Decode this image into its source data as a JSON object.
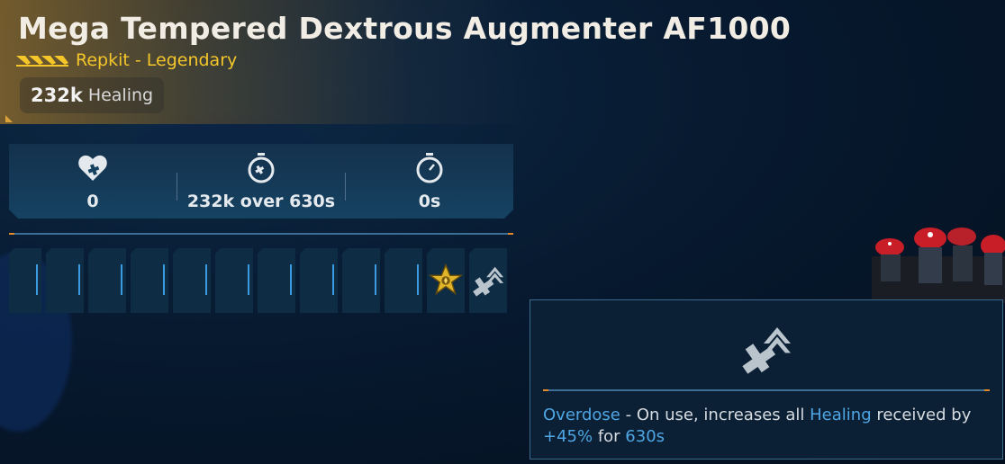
{
  "item": {
    "name": "Mega Tempered Dextrous Augmenter AF1000",
    "rarity": "Repkit - Legendary",
    "primary_stat": {
      "value": "232k",
      "label": "Healing"
    }
  },
  "stats": [
    {
      "icon": "heart-plus-icon",
      "value": "0"
    },
    {
      "icon": "timer-heal-icon",
      "value": "232k over 630s"
    },
    {
      "icon": "stopwatch-icon",
      "value": "0s"
    }
  ],
  "slots": {
    "empty_count": 10,
    "icons": [
      "legendary-star-icon",
      "overdose-icon"
    ]
  },
  "tooltip": {
    "icon": "overdose-icon",
    "name": "Overdose",
    "part1": " - On use, increases all ",
    "keyword": "Healing",
    "part2": " received by ",
    "bonus": "+45%",
    "part3": " for ",
    "duration": "630s"
  },
  "colors": {
    "rarity": "#f4c62a",
    "highlight": "#4ea6e4",
    "accent_orange": "#e08a2a",
    "panel": "#164262"
  }
}
